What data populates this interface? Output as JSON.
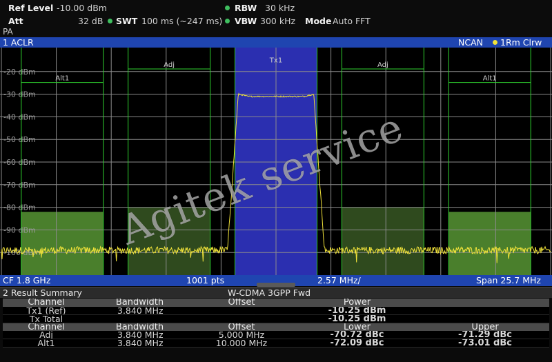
{
  "header": {
    "ref_level_label": "Ref Level",
    "ref_level_value": "-10.00 dBm",
    "att_label": "Att",
    "att_value": "32 dB",
    "swt_label": "SWT",
    "swt_value": "100 ms (~247 ms)",
    "rbw_label": "RBW",
    "rbw_value": "30 kHz",
    "vbw_label": "VBW",
    "vbw_value": "300 kHz",
    "mode_label": "Mode",
    "mode_value": "Auto FFT",
    "input_tag": "PA"
  },
  "window1": {
    "title": "1 ACLR",
    "ncan_label": "NCAN",
    "trace_label": "1Rm Clrw",
    "footer_cf": "CF 1.8 GHz",
    "footer_pts": "1001 pts",
    "footer_div": "2.57 MHz/",
    "footer_span": "Span 25.7 MHz"
  },
  "diagram": {
    "y_ticks": [
      "-20 dBm",
      "-30 dBm",
      "-40 dBm",
      "-50 dBm",
      "-60 dBm",
      "-70 dBm",
      "-80 dBm",
      "-90 dBm",
      "-100 dBm"
    ],
    "y_range_dbm": [
      -10,
      -110
    ],
    "x_range_mhz": [
      -12.85,
      12.85
    ],
    "channels": [
      {
        "name": "Alt1",
        "center_mhz": -10.0,
        "bandwidth_mhz": 3.84,
        "limit_dbm": -82,
        "label_dbm": -23,
        "kind": "alt"
      },
      {
        "name": "Adj",
        "center_mhz": -5.0,
        "bandwidth_mhz": 3.84,
        "limit_dbm": -80,
        "label_dbm": -17,
        "kind": "adj"
      },
      {
        "name": "Tx1",
        "center_mhz": 0.0,
        "bandwidth_mhz": 3.84,
        "label_dbm": -15,
        "kind": "tx"
      },
      {
        "name": "Adj",
        "center_mhz": 5.0,
        "bandwidth_mhz": 3.84,
        "limit_dbm": -80,
        "label_dbm": -17,
        "kind": "adj"
      },
      {
        "name": "Alt1",
        "center_mhz": 10.0,
        "bandwidth_mhz": 3.84,
        "limit_dbm": -82,
        "label_dbm": -23,
        "kind": "alt"
      }
    ],
    "trace": {
      "in_band_dbm": -31,
      "noise_floor_dbm": -99,
      "edge_mhz": 1.92,
      "color": "#f0e23a"
    },
    "colors": {
      "tx_fill": "#2b2fb0",
      "adj_fill": "#2f4a1e",
      "alt_fill": "#4a7f2c",
      "channel_line": "#2fd22f"
    }
  },
  "window2": {
    "title": "2 Result Summary",
    "standard": "W-CDMA 3GPP Fwd"
  },
  "results": {
    "tx_header": [
      "Channel",
      "Bandwidth",
      "Offset",
      "Power"
    ],
    "tx_rows": [
      {
        "channel": "Tx1 (Ref)",
        "bandwidth": "3.840 MHz",
        "offset": "",
        "power": "-10.25 dBm"
      },
      {
        "channel": "Tx Total",
        "bandwidth": "",
        "offset": "",
        "power": "-10.25 dBm"
      }
    ],
    "adj_header": [
      "Channel",
      "Bandwidth",
      "Offset",
      "Lower",
      "Upper"
    ],
    "adj_rows": [
      {
        "channel": "Adj",
        "bandwidth": "3.840 MHz",
        "offset": "5.000 MHz",
        "lower": "-70.72 dBc",
        "upper": "-71.29 dBc"
      },
      {
        "channel": "Alt1",
        "bandwidth": "3.840 MHz",
        "offset": "10.000 MHz",
        "lower": "-72.09 dBc",
        "upper": "-73.01 dBc"
      }
    ]
  },
  "watermark": {
    "text": "Agitek service"
  }
}
